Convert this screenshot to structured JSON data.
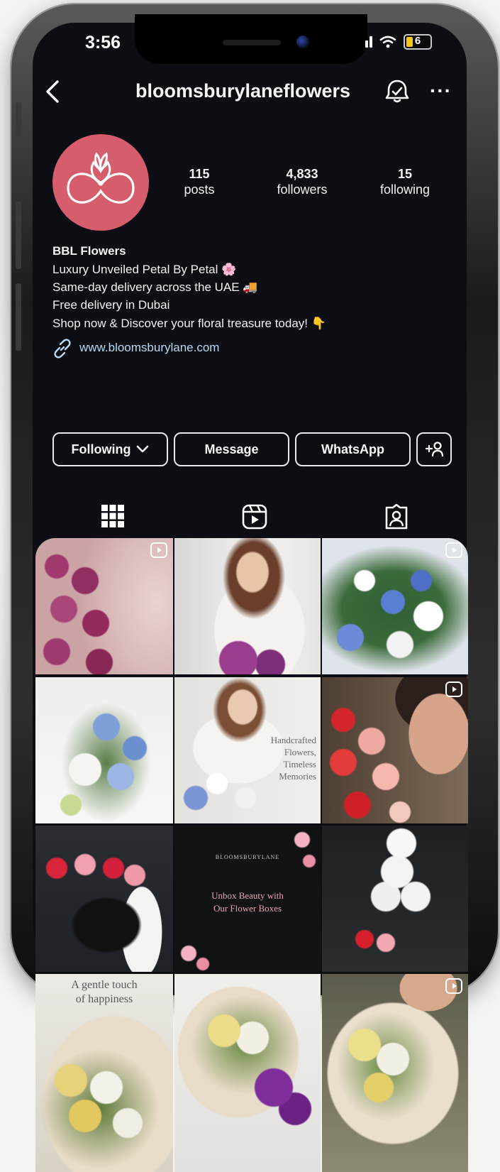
{
  "status_bar": {
    "time": "3:56",
    "battery_level": "6"
  },
  "header": {
    "username": "bloomsburylaneflowers"
  },
  "profile": {
    "avatar_color": "#d65d6c",
    "stats": [
      {
        "value": "115",
        "label": "posts"
      },
      {
        "value": "4,833",
        "label": "followers"
      },
      {
        "value": "15",
        "label": "following"
      }
    ],
    "name": "BBL Flowers",
    "bio_lines": [
      "Luxury Unveiled Petal By Petal 🌸",
      "Same-day delivery across the UAE 🚚",
      "Free delivery in Dubai",
      "Shop now & Discover your floral treasure today! 👇"
    ],
    "website": "www.bloomsburylane.com"
  },
  "actions": {
    "following": "Following",
    "message": "Message",
    "whatsapp": "WhatsApp"
  },
  "tabs": {
    "grid": "grid-icon",
    "reels": "reels-icon",
    "tagged": "tagged-icon"
  },
  "posts": {
    "post5_overlay": [
      "Handcrafted",
      "Flowers,",
      "Timeless",
      "Memories"
    ],
    "post8_brand": "BLOOMSBURYLANE",
    "post8_text": [
      "Unbox Beauty with",
      "Our Flower Boxes"
    ],
    "post10_text": [
      "A gentle touch",
      "of happiness"
    ]
  },
  "colors": {
    "screen_bg": "#0c0e13",
    "link": "#b9d7f5",
    "accent_pink": "#d65d6c"
  }
}
